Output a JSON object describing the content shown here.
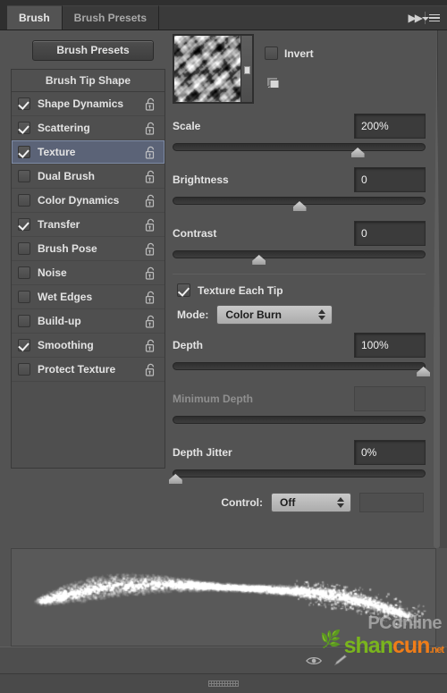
{
  "window": {
    "title": "Brush"
  },
  "tabs": [
    {
      "label": "Brush",
      "active": true
    },
    {
      "label": "Brush Presets",
      "active": false
    }
  ],
  "tab_icons": {
    "collapse": "double-chevron-right",
    "menu": "panel-menu"
  },
  "buttons": {
    "brush_presets": "Brush Presets"
  },
  "sidebar": {
    "header": "Brush Tip Shape",
    "items": [
      {
        "label": "Shape Dynamics",
        "checked": true,
        "selected": false,
        "locked": false
      },
      {
        "label": "Scattering",
        "checked": true,
        "selected": false,
        "locked": false
      },
      {
        "label": "Texture",
        "checked": true,
        "selected": true,
        "locked": false
      },
      {
        "label": "Dual Brush",
        "checked": false,
        "selected": false,
        "locked": false
      },
      {
        "label": "Color Dynamics",
        "checked": false,
        "selected": false,
        "locked": false
      },
      {
        "label": "Transfer",
        "checked": true,
        "selected": false,
        "locked": false
      },
      {
        "label": "Brush Pose",
        "checked": false,
        "selected": false,
        "locked": false
      },
      {
        "label": "Noise",
        "checked": false,
        "selected": false,
        "locked": false
      },
      {
        "label": "Wet Edges",
        "checked": false,
        "selected": false,
        "locked": false
      },
      {
        "label": "Build-up",
        "checked": false,
        "selected": false,
        "locked": false
      },
      {
        "label": "Smoothing",
        "checked": true,
        "selected": false,
        "locked": false
      },
      {
        "label": "Protect Texture",
        "checked": false,
        "selected": false,
        "locked": false
      }
    ]
  },
  "texture": {
    "swatch_name": "texture-preset-swatch",
    "invert": {
      "label": "Invert",
      "checked": false
    },
    "new_preset_icon": "new-texture-preset-icon",
    "scale": {
      "label": "Scale",
      "value": "200%",
      "percent": 73
    },
    "brightness": {
      "label": "Brightness",
      "value": "0",
      "percent": 50
    },
    "contrast": {
      "label": "Contrast",
      "value": "0",
      "percent": 34
    },
    "texture_each_tip": {
      "label": "Texture Each Tip",
      "checked": true
    },
    "mode": {
      "label": "Mode:",
      "value": "Color Burn"
    },
    "depth": {
      "label": "Depth",
      "value": "100%",
      "percent": 99
    },
    "minimum_depth": {
      "label": "Minimum Depth",
      "value": "",
      "percent": 0,
      "disabled": true
    },
    "depth_jitter": {
      "label": "Depth Jitter",
      "value": "0%",
      "percent": 1
    },
    "control": {
      "label": "Control:",
      "value": "Off"
    }
  },
  "preview": {
    "name": "brush-stroke-preview"
  },
  "footer": {
    "eye_icon": "toggle-brush-preview-icon",
    "pencil_icon": "create-new-brush-icon",
    "grip": "resize-grip"
  },
  "watermarks": {
    "pconline": "PConline",
    "shancun_a": "shan",
    "shancun_b": "cun",
    "shancun_c": ".net"
  },
  "colors": {
    "panel_bg": "#535353",
    "tab_bg": "#3a3a3a",
    "tabbar_bg": "#2f2f2f",
    "selection": "#5b6377",
    "field_bg": "#3b3b3b",
    "text": "#e3e3e3",
    "text_disabled": "#8f8f8f",
    "dropdown_bg": "#bcbcbc"
  }
}
